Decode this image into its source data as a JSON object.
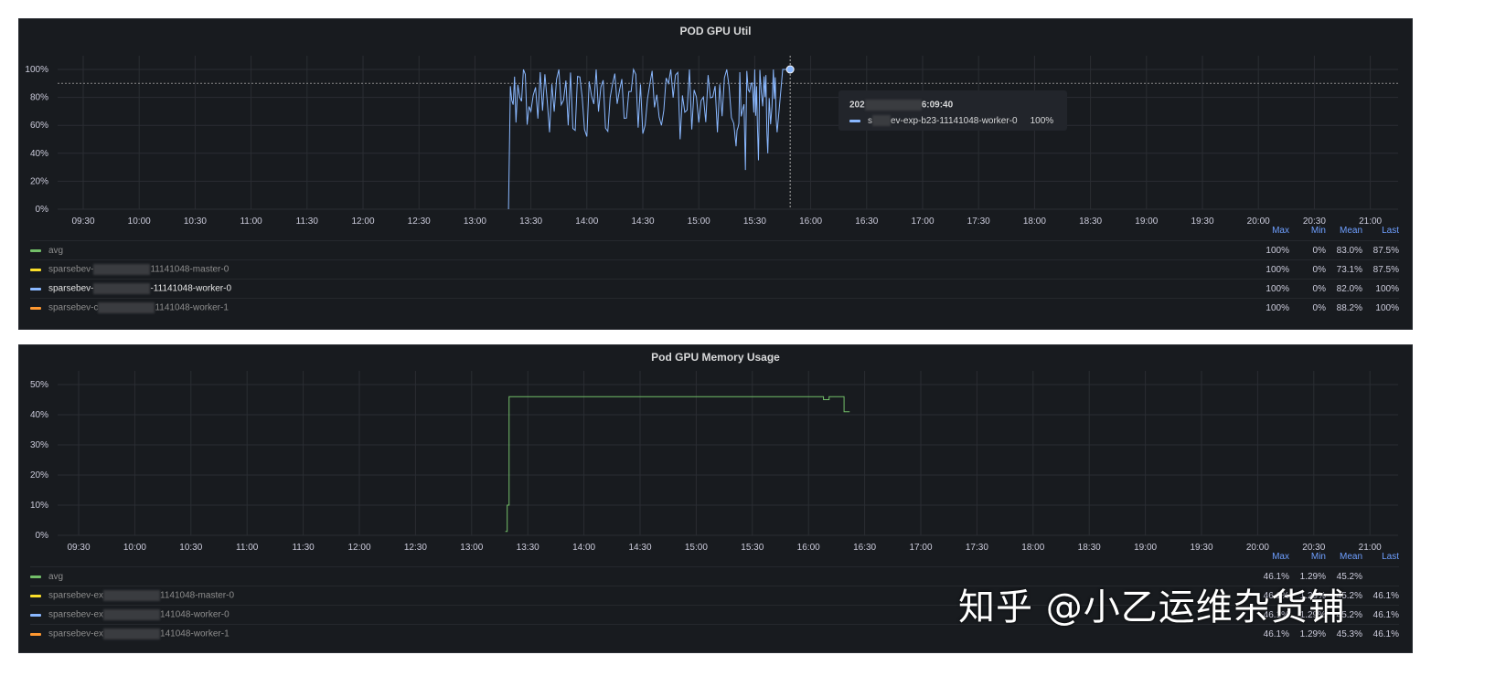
{
  "colors": {
    "avg": "#73bf69",
    "master": "#fade2a",
    "worker0": "#8ab8ff",
    "worker1": "#ff9830"
  },
  "legend_headers": [
    "Max",
    "Min",
    "Mean",
    "Last"
  ],
  "chart_data": [
    {
      "type": "line",
      "title": "POD GPU Util",
      "ylim": [
        0,
        100
      ],
      "yticks": [
        "0%",
        "20%",
        "40%",
        "60%",
        "80%",
        "100%"
      ],
      "xticks": [
        "09:30",
        "10:00",
        "10:30",
        "11:00",
        "11:30",
        "12:00",
        "12:30",
        "13:00",
        "13:30",
        "14:00",
        "14:30",
        "15:00",
        "15:30",
        "16:00",
        "16:30",
        "17:00",
        "17:30",
        "18:00",
        "18:30",
        "19:00",
        "19:30",
        "20:00",
        "20:30",
        "21:00"
      ],
      "threshold": 90,
      "series": [
        {
          "name": "worker-0",
          "color_key": "worker0",
          "x_minutes_from_0930": [
            228,
            229,
            232,
            236,
            240,
            245,
            250,
            255,
            260,
            265,
            270,
            275,
            280,
            285,
            290,
            295,
            300,
            305,
            310,
            315,
            320,
            325,
            330,
            335,
            340,
            345,
            350,
            352,
            355,
            358,
            360,
            362,
            365,
            367,
            370,
            372,
            375,
            377,
            379
          ],
          "values": [
            0,
            88,
            62,
            100,
            70,
            98,
            55,
            100,
            60,
            95,
            52,
            100,
            58,
            97,
            65,
            100,
            54,
            99,
            60,
            100,
            50,
            100,
            62,
            96,
            55,
            100,
            45,
            98,
            28,
            90,
            100,
            35,
            95,
            40,
            100,
            55,
            100,
            100,
            100
          ]
        }
      ],
      "legend": [
        {
          "name": "avg",
          "prefix": "",
          "suffix": "",
          "color_key": "avg",
          "max": "100%",
          "min": "0%",
          "mean": "83.0%",
          "last": "87.5%"
        },
        {
          "name": "",
          "prefix": "sparsebev-",
          "suffix": "11141048-master-0",
          "color_key": "master",
          "max": "100%",
          "min": "0%",
          "mean": "73.1%",
          "last": "87.5%"
        },
        {
          "name": "",
          "prefix": "sparsebev-",
          "suffix": "-11141048-worker-0",
          "color_key": "worker0",
          "max": "100%",
          "min": "0%",
          "mean": "82.0%",
          "last": "100%",
          "highlight": true
        },
        {
          "name": "",
          "prefix": "sparsebev-c",
          "suffix": "1141048-worker-1",
          "color_key": "worker1",
          "max": "100%",
          "min": "0%",
          "mean": "88.2%",
          "last": "100%"
        }
      ],
      "tooltip": {
        "time_prefix": "202",
        "time_suffix": "6:09:40",
        "series_prefix": "s",
        "series_suffix": "ev-exp-b23-11141048-worker-0",
        "value": "100%"
      }
    },
    {
      "type": "line",
      "title": "Pod GPU Memory Usage",
      "ylim": [
        0,
        50
      ],
      "yticks": [
        "0%",
        "10%",
        "20%",
        "30%",
        "40%",
        "50%"
      ],
      "xticks": [
        "09:30",
        "10:00",
        "10:30",
        "11:00",
        "11:30",
        "12:00",
        "12:30",
        "13:00",
        "13:30",
        "14:00",
        "14:30",
        "15:00",
        "15:30",
        "16:00",
        "16:30",
        "17:00",
        "17:30",
        "18:00",
        "18:30",
        "19:00",
        "19:30",
        "20:00",
        "20:30",
        "21:00"
      ],
      "series": [
        {
          "name": "avg",
          "color_key": "avg",
          "x_minutes_from_0930": [
            228,
            229,
            230,
            275,
            395,
            398,
            400,
            401,
            404,
            408,
            409,
            412
          ],
          "values": [
            1.3,
            10,
            46,
            46,
            46,
            45,
            45,
            46,
            46,
            46,
            41,
            41
          ]
        }
      ],
      "legend": [
        {
          "name": "avg",
          "prefix": "",
          "suffix": "",
          "color_key": "avg",
          "max": "46.1%",
          "min": "1.29%",
          "mean": "45.2%",
          "last": ""
        },
        {
          "name": "",
          "prefix": "sparsebev-ex",
          "suffix": "1141048-master-0",
          "color_key": "master",
          "max": "46.1%",
          "min": "1.29%",
          "mean": "45.2%",
          "last": "46.1%"
        },
        {
          "name": "",
          "prefix": "sparsebev-ex",
          "suffix": "141048-worker-0",
          "color_key": "worker0",
          "max": "46.1%",
          "min": "1.29%",
          "mean": "45.2%",
          "last": "46.1%"
        },
        {
          "name": "",
          "prefix": "sparsebev-ex",
          "suffix": "141048-worker-1",
          "color_key": "worker1",
          "max": "46.1%",
          "min": "1.29%",
          "mean": "45.3%",
          "last": "46.1%"
        }
      ]
    }
  ],
  "watermark": "知乎 @小乙运维杂货铺"
}
